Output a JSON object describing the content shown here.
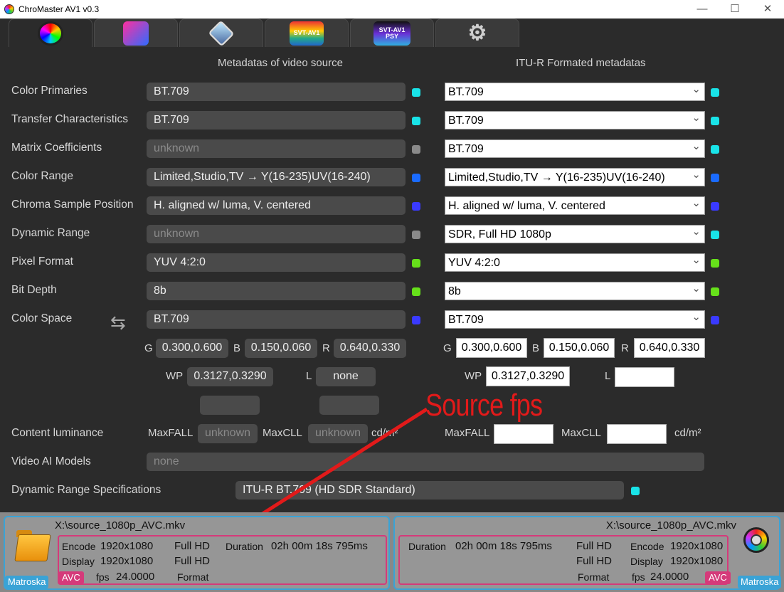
{
  "window": {
    "title": "ChroMaster AV1 v0.3",
    "minimize": "—",
    "maximize": "☐",
    "close": "✕"
  },
  "tabs": [
    {
      "icon": "color-wheel-icon",
      "label": ""
    },
    {
      "icon": "runner-icon",
      "label": ""
    },
    {
      "icon": "diamond-icon",
      "label": ""
    },
    {
      "icon": "svt-av1-logo",
      "label": "SVT-AV1"
    },
    {
      "icon": "svt-av1-psy-logo",
      "label": "SVT-AV1 PSY"
    },
    {
      "icon": "gears-icon",
      "label": ""
    }
  ],
  "headers": {
    "source": "Metadatas of video source",
    "formatted": "ITU-R Formated metadatas"
  },
  "rows": [
    {
      "label": "Color Primaries",
      "source": "BT.709",
      "source_dim": false,
      "source_color": "#19e3e8",
      "target": "BT.709",
      "target_color": "#19e3e8"
    },
    {
      "label": "Transfer Characteristics",
      "source": "BT.709",
      "source_dim": false,
      "source_color": "#19e3e8",
      "target": "BT.709",
      "target_color": "#19e3e8"
    },
    {
      "label": "Matrix Coefficients",
      "source": "unknown",
      "source_dim": true,
      "source_color": "#8a8a8a",
      "target": "BT.709",
      "target_color": "#19e3e8"
    },
    {
      "label": "Color Range",
      "source": "Limited,Studio,TV → Y(16-235)UV(16-240)",
      "source_dim": false,
      "source_color": "#1a6bff",
      "target": "Limited,Studio,TV → Y(16-235)UV(16-240)",
      "target_color": "#1a6bff"
    },
    {
      "label": "Chroma Sample Position",
      "source": "H. aligned w/ luma, V. centered",
      "source_dim": false,
      "source_color": "#3a3aff",
      "target": "H. aligned w/ luma, V. centered",
      "target_color": "#3a3aff"
    },
    {
      "label": "Dynamic Range",
      "source": "unknown",
      "source_dim": true,
      "source_color": "#8a8a8a",
      "target": "SDR, Full HD 1080p",
      "target_color": "#19e3e8"
    },
    {
      "label": "Pixel Format",
      "source": "YUV 4:2:0",
      "source_dim": false,
      "source_color": "#66e01a",
      "target": "YUV 4:2:0",
      "target_color": "#66e01a"
    },
    {
      "label": "Bit Depth",
      "source": "8b",
      "source_dim": false,
      "source_color": "#66e01a",
      "target": "8b",
      "target_color": "#66e01a"
    },
    {
      "label": "Color Space",
      "source": "BT.709",
      "source_dim": false,
      "source_color": "#3a3aff",
      "target": "BT.709",
      "target_color": "#3a3aff"
    }
  ],
  "primaries": {
    "g_label": "G",
    "b_label": "B",
    "r_label": "R",
    "wp_label": "WP",
    "l_label": "L",
    "source": {
      "g": "0.300,0.600",
      "b": "0.150,0.060",
      "r": "0.640,0.330",
      "wp": "0.3127,0.3290",
      "l": "none"
    },
    "target": {
      "g": "0.300,0.600",
      "b": "0.150,0.060",
      "r": "0.640,0.330",
      "wp": "0.3127,0.3290",
      "l": ""
    }
  },
  "luminance": {
    "label": "Content luminance",
    "maxfall_label": "MaxFALL",
    "maxcll_label": "MaxCLL",
    "unit": "cd/m²",
    "source_maxfall": "unknown",
    "source_maxcll": "unknown",
    "target_maxfall": "",
    "target_maxcll": ""
  },
  "ai_models": {
    "label": "Video AI Models",
    "value": "none"
  },
  "dr_spec": {
    "label": "Dynamic Range Specifications",
    "value": "ITU-R BT.709 (HD SDR Standard)",
    "color": "#19e3e8"
  },
  "annotation": {
    "text": "Source fps",
    "color": "#e21a1a"
  },
  "source_file": {
    "path": "X:\\source_1080p_AVC.mkv",
    "container": "Matroska",
    "codec": "AVC",
    "encode_label": "Encode",
    "encode": "1920x1080",
    "encode_class": "Full HD",
    "display_label": "Display",
    "display": "1920x1080",
    "display_class": "Full HD",
    "fps_label": "fps",
    "fps": "24.0000",
    "format_label": "Format",
    "duration_label": "Duration",
    "duration": "02h 00m 18s 795ms"
  },
  "output_file": {
    "path": "X:\\source_1080p_AVC.mkv",
    "container": "Matroska",
    "codec": "AVC",
    "encode_label": "Encode",
    "encode": "1920x1080",
    "encode_class": "Full HD",
    "display_label": "Display",
    "display": "1920x1080",
    "display_class": "Full HD",
    "fps_label": "fps",
    "fps": "24.0000",
    "format_label": "Format",
    "duration_label": "Duration",
    "duration": "02h 00m 18s 795ms"
  }
}
